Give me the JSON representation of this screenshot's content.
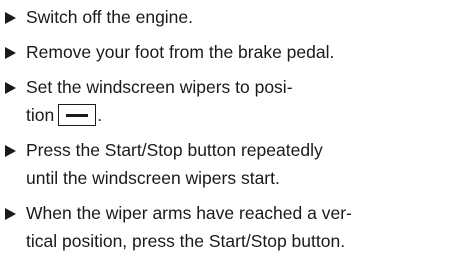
{
  "steps": [
    {
      "text": "Switch off the engine."
    },
    {
      "text": "Remove your foot from the brake pedal."
    },
    {
      "text_before": "Set the windscreen wipers to posi-\ntion",
      "symbol_icon": "wiper-position-symbol",
      "text_after": "."
    },
    {
      "text": "Press the Start/Stop button repeatedly\nuntil the windscreen wipers start."
    },
    {
      "text": "When the wiper arms have reached a ver-\ntical position, press the Start/Stop button."
    }
  ]
}
